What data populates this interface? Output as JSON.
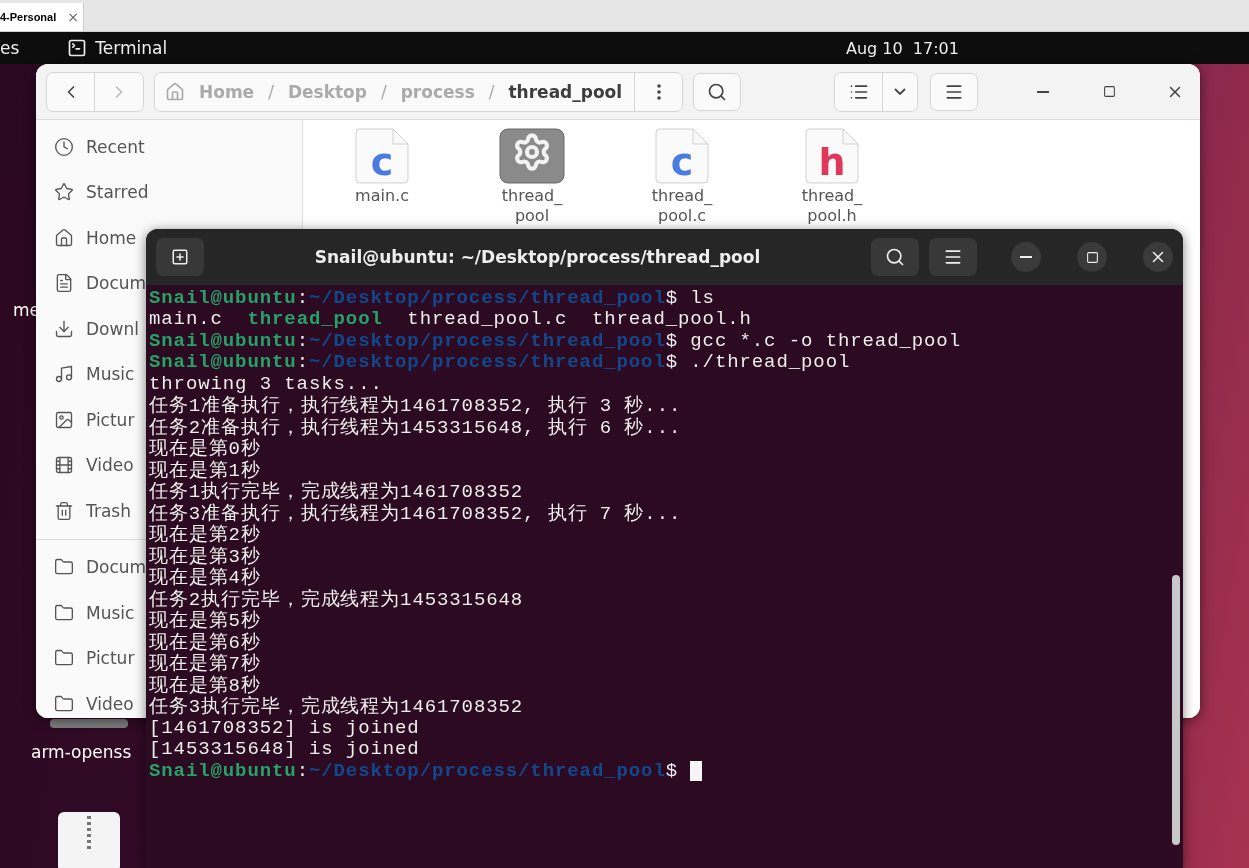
{
  "browser_tab": {
    "label": "4-Personal",
    "close": "×"
  },
  "top_bar": {
    "activities": "es",
    "app": "Terminal",
    "clock": "Aug 10  17:01"
  },
  "desktop_icons": [
    {
      "label": "me"
    },
    {
      "label": "arm-openss"
    }
  ],
  "file_manager": {
    "nav": [
      {
        "disabled": false
      },
      {
        "disabled": true
      }
    ],
    "path": [
      {
        "label": "Home",
        "current": false
      },
      {
        "label": "Desktop",
        "current": false
      },
      {
        "label": "process",
        "current": false
      },
      {
        "label": "thread_pool",
        "current": true
      }
    ],
    "path_separator": "/",
    "sidebar": {
      "places": [
        {
          "label": "Recent"
        },
        {
          "label": "Starred"
        },
        {
          "label": "Home"
        },
        {
          "label": "Docum"
        },
        {
          "label": "Downl"
        },
        {
          "label": "Music"
        },
        {
          "label": "Pictur"
        },
        {
          "label": "Video"
        },
        {
          "label": "Trash"
        }
      ],
      "bookmarks": [
        {
          "label": "Docum"
        },
        {
          "label": "Music"
        },
        {
          "label": "Pictur"
        },
        {
          "label": "Video"
        }
      ]
    },
    "files": [
      {
        "name": "main.c",
        "kind": "c",
        "glyph": "c"
      },
      {
        "name": "thread_pool",
        "kind": "exec"
      },
      {
        "name": "thread_pool.c",
        "kind": "c",
        "glyph": "c"
      },
      {
        "name": "thread_pool.h",
        "kind": "h",
        "glyph": "h"
      }
    ]
  },
  "terminal": {
    "title": "Snail@ubuntu: ~/Desktop/process/thread_pool",
    "lines": [
      {
        "segments": [
          {
            "kind": "user",
            "text": "Snail@ubuntu"
          },
          {
            "kind": "text",
            "text": ":"
          },
          {
            "kind": "path",
            "text": "~/Desktop/process/thread_pool"
          },
          {
            "kind": "text",
            "text": "$ ls"
          }
        ]
      },
      {
        "segments": [
          {
            "kind": "text",
            "text": "main.c  "
          },
          {
            "kind": "exec",
            "text": "thread_pool"
          },
          {
            "kind": "text",
            "text": "  thread_pool.c  thread_pool.h"
          }
        ]
      },
      {
        "segments": [
          {
            "kind": "user",
            "text": "Snail@ubuntu"
          },
          {
            "kind": "text",
            "text": ":"
          },
          {
            "kind": "path",
            "text": "~/Desktop/process/thread_pool"
          },
          {
            "kind": "text",
            "text": "$ gcc *.c -o thread_pool"
          }
        ]
      },
      {
        "segments": [
          {
            "kind": "user",
            "text": "Snail@ubuntu"
          },
          {
            "kind": "text",
            "text": ":"
          },
          {
            "kind": "path",
            "text": "~/Desktop/process/thread_pool"
          },
          {
            "kind": "text",
            "text": "$ ./thread_pool"
          }
        ]
      },
      {
        "segments": [
          {
            "kind": "text",
            "text": "throwing 3 tasks..."
          }
        ]
      },
      {
        "segments": [
          {
            "kind": "text",
            "text": "任务1准备执行，执行线程为1461708352, 执行 3 秒..."
          }
        ]
      },
      {
        "segments": [
          {
            "kind": "text",
            "text": "任务2准备执行，执行线程为1453315648, 执行 6 秒..."
          }
        ]
      },
      {
        "segments": [
          {
            "kind": "text",
            "text": "现在是第0秒"
          }
        ]
      },
      {
        "segments": [
          {
            "kind": "text",
            "text": "现在是第1秒"
          }
        ]
      },
      {
        "segments": [
          {
            "kind": "text",
            "text": "任务1执行完毕，完成线程为1461708352"
          }
        ]
      },
      {
        "segments": [
          {
            "kind": "text",
            "text": "任务3准备执行，执行线程为1461708352, 执行 7 秒..."
          }
        ]
      },
      {
        "segments": [
          {
            "kind": "text",
            "text": "现在是第2秒"
          }
        ]
      },
      {
        "segments": [
          {
            "kind": "text",
            "text": "现在是第3秒"
          }
        ]
      },
      {
        "segments": [
          {
            "kind": "text",
            "text": "现在是第4秒"
          }
        ]
      },
      {
        "segments": [
          {
            "kind": "text",
            "text": "任务2执行完毕，完成线程为1453315648"
          }
        ]
      },
      {
        "segments": [
          {
            "kind": "text",
            "text": "现在是第5秒"
          }
        ]
      },
      {
        "segments": [
          {
            "kind": "text",
            "text": "现在是第6秒"
          }
        ]
      },
      {
        "segments": [
          {
            "kind": "text",
            "text": "现在是第7秒"
          }
        ]
      },
      {
        "segments": [
          {
            "kind": "text",
            "text": "现在是第8秒"
          }
        ]
      },
      {
        "segments": [
          {
            "kind": "text",
            "text": "任务3执行完毕，完成线程为1461708352"
          }
        ]
      },
      {
        "segments": [
          {
            "kind": "text",
            "text": "[1461708352] is joined"
          }
        ]
      },
      {
        "segments": [
          {
            "kind": "text",
            "text": "[1453315648] is joined"
          }
        ]
      },
      {
        "segments": [
          {
            "kind": "user",
            "text": "Snail@ubuntu"
          },
          {
            "kind": "text",
            "text": ":"
          },
          {
            "kind": "path",
            "text": "~/Desktop/process/thread_pool"
          },
          {
            "kind": "text",
            "text": "$ "
          }
        ],
        "cursor": true
      }
    ]
  }
}
